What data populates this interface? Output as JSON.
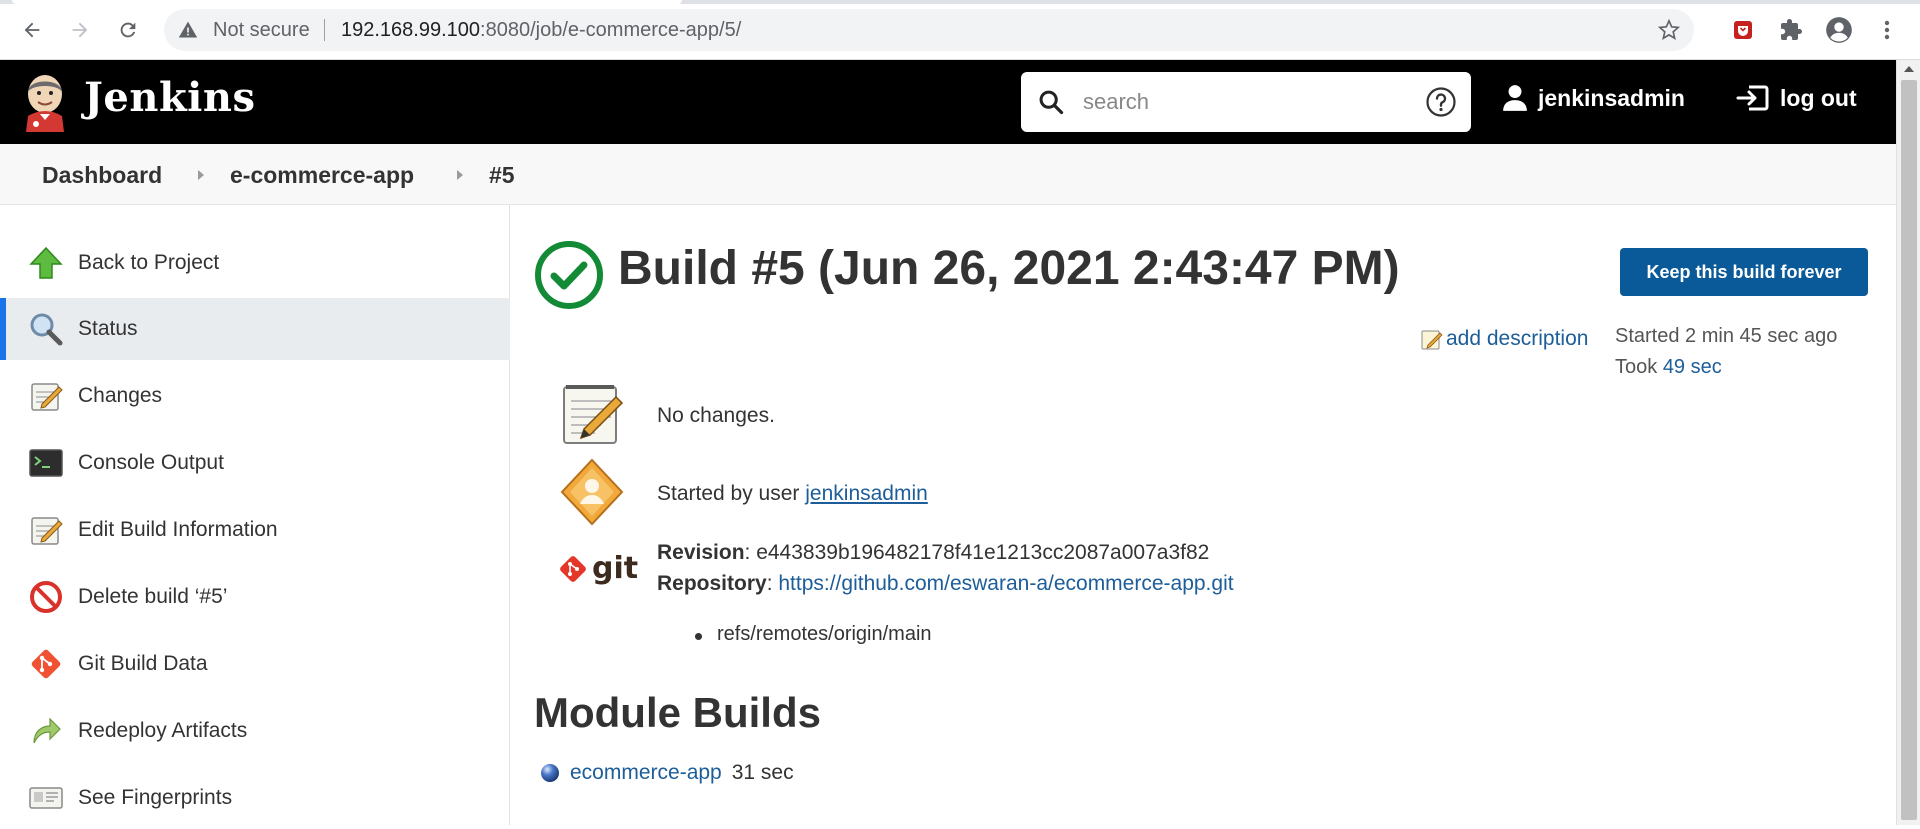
{
  "browser": {
    "security_label": "Not secure",
    "url_host": "192.168.99.100",
    "url_rest": ":8080/job/e-commerce-app/5/"
  },
  "header": {
    "brand": "Jenkins",
    "search_placeholder": "search",
    "user": "jenkinsadmin",
    "logout": "log out"
  },
  "breadcrumbs": [
    "Dashboard",
    "e-commerce-app",
    "#5"
  ],
  "sidebar": {
    "items": [
      {
        "label": "Back to Project",
        "icon": "green-up-arrow-icon"
      },
      {
        "label": "Status",
        "icon": "magnifier-icon",
        "active": true
      },
      {
        "label": "Changes",
        "icon": "notepad-icon"
      },
      {
        "label": "Console Output",
        "icon": "terminal-icon"
      },
      {
        "label": "Edit Build Information",
        "icon": "notepad-icon"
      },
      {
        "label": "Delete build ‘#5’",
        "icon": "no-entry-icon"
      },
      {
        "label": "Git Build Data",
        "icon": "git-logo-icon"
      },
      {
        "label": "Redeploy Artifacts",
        "icon": "redeploy-arrow-icon"
      },
      {
        "label": "See Fingerprints",
        "icon": "fingerprint-card-icon"
      }
    ]
  },
  "build": {
    "title": "Build #5 (Jun 26, 2021 2:43:47 PM)",
    "keep_button": "Keep this build forever",
    "add_description": "add description",
    "started_prefix": "Started ",
    "started_ago": "2 min 45 sec ago",
    "took_prefix": "Took ",
    "took_value": "49 sec",
    "changes_text": "No changes.",
    "started_by_prefix": "Started by user ",
    "started_by_user": "jenkinsadmin",
    "revision_label": "Revision",
    "revision_value": "e443839b196482178f41e1213cc2087a007a3f82",
    "repository_label": "Repository",
    "repository_url": "https://github.com/eswaran-a/ecommerce-app.git",
    "branch": "refs/remotes/origin/main",
    "git_logo_text": "git"
  },
  "modules": {
    "heading": "Module Builds",
    "items": [
      {
        "name": "ecommerce-app",
        "duration": "31 sec"
      }
    ]
  },
  "colors": {
    "header_bg": "#000000",
    "link": "#1d5d99",
    "button": "#0a5a9a",
    "success": "#138a36"
  }
}
